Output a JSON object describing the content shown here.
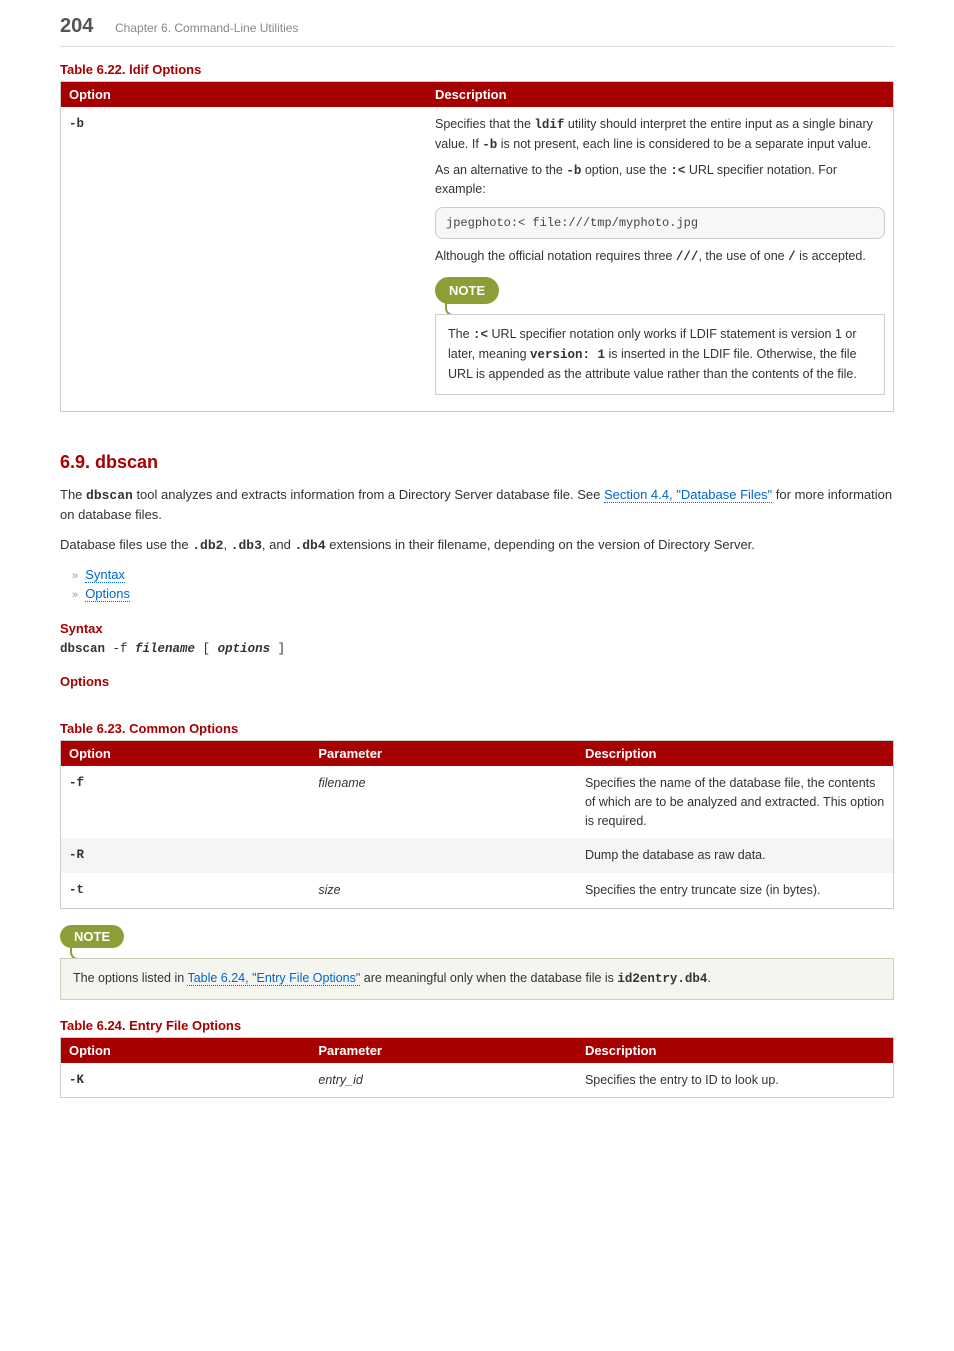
{
  "header": {
    "page_number": "204",
    "chapter": "Chapter 6. Command-Line Utilities"
  },
  "table_622": {
    "caption": "Table 6.22. ldif Options",
    "col_option": "Option",
    "col_desc": "Description",
    "row_b": {
      "option": "-b",
      "desc_p1_a": "Specifies that the ",
      "desc_p1_b": "ldif",
      "desc_p1_c": " utility should interpret the entire input as a single binary value. If ",
      "desc_p1_d": "-b",
      "desc_p1_e": " is not present, each line is considered to be a separate input value.",
      "desc_p2_a": "As an alternative to the ",
      "desc_p2_b": "-b",
      "desc_p2_c": " option, use the ",
      "desc_p2_d": ":<",
      "desc_p2_e": " URL specifier notation. For example:",
      "code": "jpegphoto:< file:///tmp/myphoto.jpg",
      "desc_p3_a": "Although the official notation requires three ",
      "desc_p3_b": "///",
      "desc_p3_c": ", the use of one ",
      "desc_p3_d": "/",
      "desc_p3_e": " is accepted.",
      "note_label": "NOTE",
      "note_a": "The ",
      "note_b": ":<",
      "note_c": " URL specifier notation only works if LDIF statement is version 1 or later, meaning ",
      "note_d": "version: 1",
      "note_e": " is inserted in the LDIF file. Otherwise, the file URL is appended as the attribute value rather than the contents of the file."
    }
  },
  "section_69": {
    "heading": "6.9. dbscan",
    "p1_a": "The ",
    "p1_b": "dbscan",
    "p1_c": " tool analyzes and extracts information from a Directory Server database file. See ",
    "p1_link": "Section 4.4, \"Database Files\"",
    "p1_d": " for more information on database files.",
    "p2_a": "Database files use the ",
    "p2_b": ".db2",
    "p2_c": ", ",
    "p2_d": ".db3",
    "p2_e": ", and ",
    "p2_f": ".db4",
    "p2_g": " extensions in their filename, depending on the version of Directory Server.",
    "list_syntax": "Syntax",
    "list_options": "Options",
    "syntax_heading": "Syntax",
    "syntax_a": "dbscan",
    "syntax_b": " -f ",
    "syntax_c": "filename",
    "syntax_d": " [ ",
    "syntax_e": "options",
    "syntax_f": " ]",
    "options_heading": "Options"
  },
  "table_623": {
    "caption": "Table 6.23. Common Options",
    "col_option": "Option",
    "col_param": "Parameter",
    "col_desc": "Description",
    "row_f": {
      "option": "-f",
      "param": "filename",
      "desc": "Specifies the name of the database file, the contents of which are to be analyzed and extracted. This option is required."
    },
    "row_r": {
      "option": "-R",
      "param": "",
      "desc": "Dump the database as raw data."
    },
    "row_t": {
      "option": "-t",
      "param": "size",
      "desc": "Specifies the entry truncate size (in bytes)."
    }
  },
  "note2": {
    "label": "NOTE",
    "a": "The options listed in ",
    "link": "Table 6.24, \"Entry File Options\"",
    "b": " are meaningful only when the database file is ",
    "c": "id2entry.db4",
    "d": "."
  },
  "table_624": {
    "caption": "Table 6.24. Entry File Options",
    "col_option": "Option",
    "col_param": "Parameter",
    "col_desc": "Description",
    "row_k": {
      "option": "-K",
      "param": "entry_id",
      "desc": "Specifies the entry to ID to look up."
    }
  }
}
